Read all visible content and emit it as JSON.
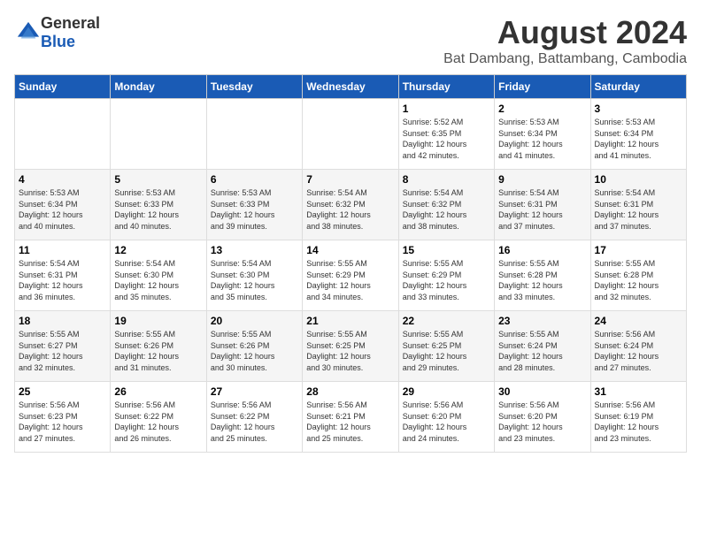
{
  "header": {
    "logo_general": "General",
    "logo_blue": "Blue",
    "title": "August 2024",
    "subtitle": "Bat Dambang, Battambang, Cambodia"
  },
  "weekdays": [
    "Sunday",
    "Monday",
    "Tuesday",
    "Wednesday",
    "Thursday",
    "Friday",
    "Saturday"
  ],
  "weeks": [
    [
      {
        "day": "",
        "info": ""
      },
      {
        "day": "",
        "info": ""
      },
      {
        "day": "",
        "info": ""
      },
      {
        "day": "",
        "info": ""
      },
      {
        "day": "1",
        "info": "Sunrise: 5:52 AM\nSunset: 6:35 PM\nDaylight: 12 hours\nand 42 minutes."
      },
      {
        "day": "2",
        "info": "Sunrise: 5:53 AM\nSunset: 6:34 PM\nDaylight: 12 hours\nand 41 minutes."
      },
      {
        "day": "3",
        "info": "Sunrise: 5:53 AM\nSunset: 6:34 PM\nDaylight: 12 hours\nand 41 minutes."
      }
    ],
    [
      {
        "day": "4",
        "info": "Sunrise: 5:53 AM\nSunset: 6:34 PM\nDaylight: 12 hours\nand 40 minutes."
      },
      {
        "day": "5",
        "info": "Sunrise: 5:53 AM\nSunset: 6:33 PM\nDaylight: 12 hours\nand 40 minutes."
      },
      {
        "day": "6",
        "info": "Sunrise: 5:53 AM\nSunset: 6:33 PM\nDaylight: 12 hours\nand 39 minutes."
      },
      {
        "day": "7",
        "info": "Sunrise: 5:54 AM\nSunset: 6:32 PM\nDaylight: 12 hours\nand 38 minutes."
      },
      {
        "day": "8",
        "info": "Sunrise: 5:54 AM\nSunset: 6:32 PM\nDaylight: 12 hours\nand 38 minutes."
      },
      {
        "day": "9",
        "info": "Sunrise: 5:54 AM\nSunset: 6:31 PM\nDaylight: 12 hours\nand 37 minutes."
      },
      {
        "day": "10",
        "info": "Sunrise: 5:54 AM\nSunset: 6:31 PM\nDaylight: 12 hours\nand 37 minutes."
      }
    ],
    [
      {
        "day": "11",
        "info": "Sunrise: 5:54 AM\nSunset: 6:31 PM\nDaylight: 12 hours\nand 36 minutes."
      },
      {
        "day": "12",
        "info": "Sunrise: 5:54 AM\nSunset: 6:30 PM\nDaylight: 12 hours\nand 35 minutes."
      },
      {
        "day": "13",
        "info": "Sunrise: 5:54 AM\nSunset: 6:30 PM\nDaylight: 12 hours\nand 35 minutes."
      },
      {
        "day": "14",
        "info": "Sunrise: 5:55 AM\nSunset: 6:29 PM\nDaylight: 12 hours\nand 34 minutes."
      },
      {
        "day": "15",
        "info": "Sunrise: 5:55 AM\nSunset: 6:29 PM\nDaylight: 12 hours\nand 33 minutes."
      },
      {
        "day": "16",
        "info": "Sunrise: 5:55 AM\nSunset: 6:28 PM\nDaylight: 12 hours\nand 33 minutes."
      },
      {
        "day": "17",
        "info": "Sunrise: 5:55 AM\nSunset: 6:28 PM\nDaylight: 12 hours\nand 32 minutes."
      }
    ],
    [
      {
        "day": "18",
        "info": "Sunrise: 5:55 AM\nSunset: 6:27 PM\nDaylight: 12 hours\nand 32 minutes."
      },
      {
        "day": "19",
        "info": "Sunrise: 5:55 AM\nSunset: 6:26 PM\nDaylight: 12 hours\nand 31 minutes."
      },
      {
        "day": "20",
        "info": "Sunrise: 5:55 AM\nSunset: 6:26 PM\nDaylight: 12 hours\nand 30 minutes."
      },
      {
        "day": "21",
        "info": "Sunrise: 5:55 AM\nSunset: 6:25 PM\nDaylight: 12 hours\nand 30 minutes."
      },
      {
        "day": "22",
        "info": "Sunrise: 5:55 AM\nSunset: 6:25 PM\nDaylight: 12 hours\nand 29 minutes."
      },
      {
        "day": "23",
        "info": "Sunrise: 5:55 AM\nSunset: 6:24 PM\nDaylight: 12 hours\nand 28 minutes."
      },
      {
        "day": "24",
        "info": "Sunrise: 5:56 AM\nSunset: 6:24 PM\nDaylight: 12 hours\nand 27 minutes."
      }
    ],
    [
      {
        "day": "25",
        "info": "Sunrise: 5:56 AM\nSunset: 6:23 PM\nDaylight: 12 hours\nand 27 minutes."
      },
      {
        "day": "26",
        "info": "Sunrise: 5:56 AM\nSunset: 6:22 PM\nDaylight: 12 hours\nand 26 minutes."
      },
      {
        "day": "27",
        "info": "Sunrise: 5:56 AM\nSunset: 6:22 PM\nDaylight: 12 hours\nand 25 minutes."
      },
      {
        "day": "28",
        "info": "Sunrise: 5:56 AM\nSunset: 6:21 PM\nDaylight: 12 hours\nand 25 minutes."
      },
      {
        "day": "29",
        "info": "Sunrise: 5:56 AM\nSunset: 6:20 PM\nDaylight: 12 hours\nand 24 minutes."
      },
      {
        "day": "30",
        "info": "Sunrise: 5:56 AM\nSunset: 6:20 PM\nDaylight: 12 hours\nand 23 minutes."
      },
      {
        "day": "31",
        "info": "Sunrise: 5:56 AM\nSunset: 6:19 PM\nDaylight: 12 hours\nand 23 minutes."
      }
    ]
  ]
}
